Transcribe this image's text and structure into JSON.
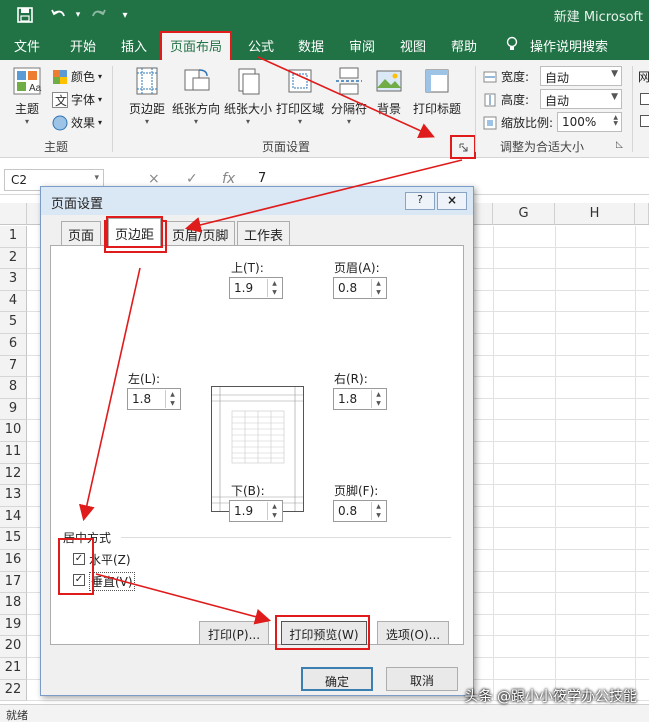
{
  "window": {
    "doc_title": "新建 Microsoft"
  },
  "qat": {
    "save_icon": "save-icon",
    "undo_icon": "undo-icon",
    "redo_icon": "redo-icon",
    "customize_icon": "chevron-down-icon"
  },
  "ribbon_tabs": [
    {
      "label": "文件"
    },
    {
      "label": "开始"
    },
    {
      "label": "插入"
    },
    {
      "label": "页面布局"
    },
    {
      "label": "公式"
    },
    {
      "label": "数据"
    },
    {
      "label": "审阅"
    },
    {
      "label": "视图"
    },
    {
      "label": "帮助"
    },
    {
      "label": "操作说明搜索"
    }
  ],
  "ribbon": {
    "themes": {
      "big_label": "主题",
      "colors": "颜色",
      "fonts": "字体",
      "effects": "效果",
      "group": "主题"
    },
    "page_setup": {
      "margins": "页边距",
      "orientation": "纸张方向",
      "size": "纸张大小",
      "print_area": "打印区域",
      "breaks": "分隔符",
      "background": "背景",
      "print_titles": "打印标题",
      "group": "页面设置"
    },
    "scale": {
      "width_label": "宽度:",
      "width_value": "自动",
      "height_label": "高度:",
      "height_value": "自动",
      "scale_label": "缩放比例:",
      "scale_value": "100%",
      "group": "调整为合适大小"
    },
    "sheet_options_partial": "网"
  },
  "formula_bar": {
    "name_box": "C2",
    "cancel": "×",
    "enter": "✓",
    "fx": "fx",
    "value": "7"
  },
  "sheet": {
    "columns": [
      "G",
      "H"
    ],
    "rows": [
      "1",
      "2",
      "3",
      "4",
      "5",
      "6",
      "7",
      "8",
      "9",
      "10",
      "11",
      "12",
      "13",
      "14",
      "15",
      "16",
      "17",
      "18",
      "19",
      "20",
      "21",
      "22"
    ],
    "status": "就绪"
  },
  "dialog": {
    "title": "页面设置",
    "help": "?",
    "close": "×",
    "tabs": [
      {
        "label": "页面"
      },
      {
        "label": "页边距"
      },
      {
        "label": "页眉/页脚"
      },
      {
        "label": "工作表"
      }
    ],
    "fields": {
      "top": {
        "label": "上(T):",
        "value": "1.9"
      },
      "header": {
        "label": "页眉(A):",
        "value": "0.8"
      },
      "left": {
        "label": "左(L):",
        "value": "1.8"
      },
      "right": {
        "label": "右(R):",
        "value": "1.8"
      },
      "bottom": {
        "label": "下(B):",
        "value": "1.9"
      },
      "footer": {
        "label": "页脚(F):",
        "value": "0.8"
      }
    },
    "center_section": "居中方式",
    "horizontally": {
      "label": "水平(Z)",
      "checked": true
    },
    "vertically": {
      "label": "垂直(V)",
      "checked": true
    },
    "buttons": {
      "print": "打印(P)...",
      "preview": "打印预览(W)",
      "options": "选项(O)...",
      "ok": "确定",
      "cancel": "取消"
    }
  },
  "watermark": "头条 @跟小小筱学办公技能",
  "colors": {
    "excel_green": "#217346",
    "highlight_red": "#e01b1b"
  }
}
